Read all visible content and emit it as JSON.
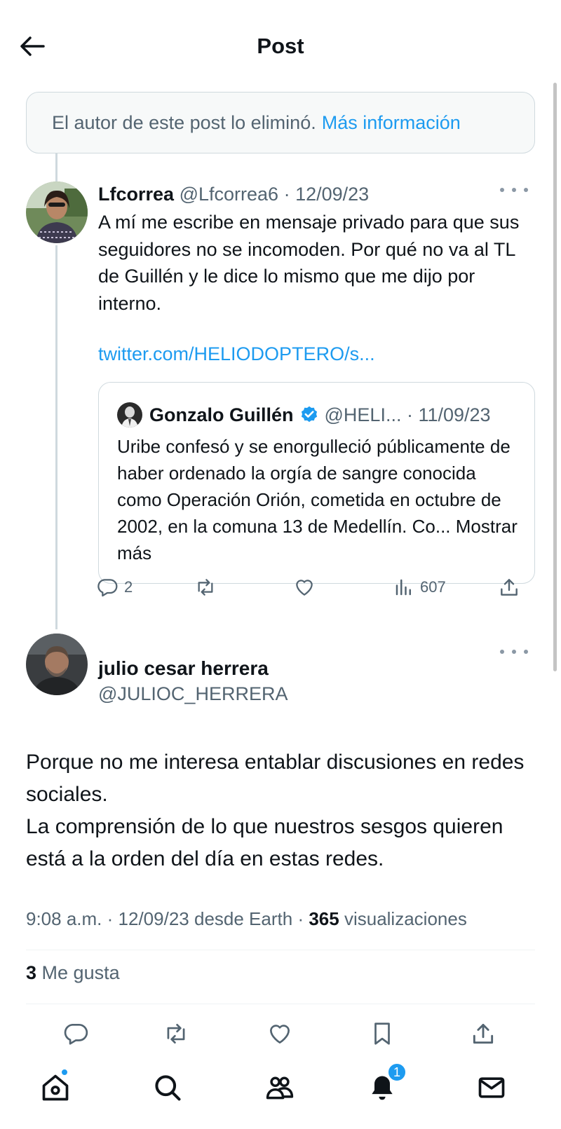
{
  "header": {
    "title": "Post"
  },
  "deleted_notice": {
    "text": "El autor de este post lo eliminó.",
    "link": "Más información"
  },
  "parent_tweet": {
    "name": "Lfcorrea",
    "handle": "@Lfcorrea6",
    "date": "12/09/23",
    "text": "A mí me escribe en mensaje privado para que sus seguidores no se incomoden. Por qué no va al TL de Guillén y le dice lo mismo que me dijo por interno.",
    "link": "twitter.com/HELIODOPTERO/s...",
    "quote": {
      "name": "Gonzalo Guillén",
      "handle": "@HELI...",
      "date": "11/09/23",
      "text": "Uribe confesó y se enorgulleció públicamente de haber ordenado la orgía de sangre conocida como Operación Orión, cometida en octubre de 2002, en la comuna 13 de Medellín. Co...",
      "show_more": "Mostrar más"
    },
    "actions": {
      "replies": "2",
      "views": "607"
    }
  },
  "reply_tweet": {
    "name": "julio cesar herrera",
    "handle": "@JULIOC_HERRERA",
    "text_line1": "Porque no me interesa entablar discusiones en redes sociales.",
    "text_line2": "La comprensión de lo que nuestros sesgos quieren está a la orden del día en estas redes.",
    "time": "9:08 a.m.",
    "date": "12/09/23",
    "source": "desde Earth",
    "views_count": "365",
    "views_label": "visualizaciones",
    "likes_count": "3",
    "likes_label": "Me gusta"
  },
  "bottom_nav": {
    "notifications_badge": "1"
  },
  "colors": {
    "accent": "#1d9bf0",
    "text": "#0f1419",
    "muted": "#536471",
    "border": "#cfd9de"
  }
}
